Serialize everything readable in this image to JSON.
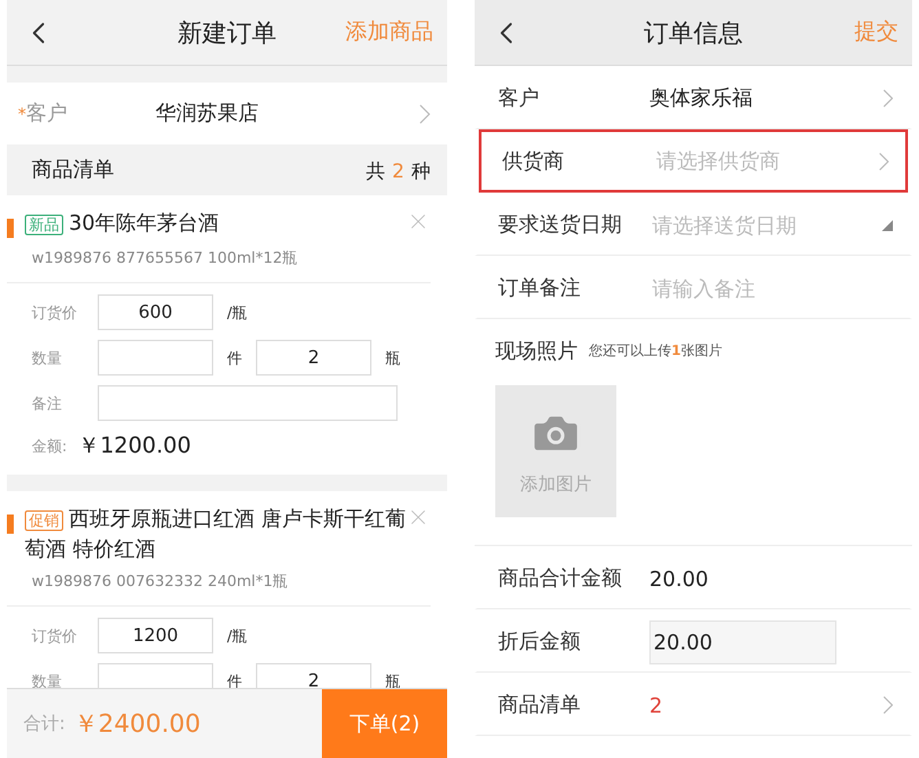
{
  "left_screen": {
    "header": {
      "title": "新建订单",
      "action": "添加商品"
    },
    "customer": {
      "label": "客户",
      "required_mark": "*",
      "value": "华润苏果店"
    },
    "list_header": {
      "title": "商品清单",
      "count_prefix": "共",
      "count": "2",
      "count_suffix": "种"
    },
    "products": [
      {
        "tag": "新品",
        "color": "#3cb07a",
        "title": "30年陈年茅台酒",
        "codes": "w1989876  877655567    100ml*12瓶",
        "rows": [
          {
            "kind": "price",
            "label": "订货价",
            "value": "600",
            "unit": "/瓶"
          },
          {
            "kind": "qty",
            "label": "数量",
            "value": "",
            "unit": "件",
            "value2": "2",
            "unit2": "瓶"
          },
          {
            "kind": "note",
            "label": "备注",
            "value": ""
          }
        ],
        "amount_label": "金额:",
        "amount": "￥1200.00"
      },
      {
        "tag": "促销",
        "color": "#f08a3c",
        "title": "西班牙原瓶进口红酒 唐卢卡斯干红葡萄酒  特价红酒",
        "codes": "w1989876  007632332    240ml*1瓶",
        "rows": [
          {
            "kind": "price",
            "label": "订货价",
            "value": "1200",
            "unit": "/瓶"
          },
          {
            "kind": "qty",
            "label": "数量",
            "value": "",
            "unit": "件",
            "value2": "2",
            "unit2": "瓶"
          }
        ]
      }
    ],
    "footer": {
      "total_label": "合计:",
      "total": "￥2400.00",
      "submit": "下单(2)"
    }
  },
  "right_screen": {
    "header": {
      "title": "订单信息",
      "action": "提交"
    },
    "rows": [
      {
        "kind": "link",
        "label": "客户",
        "value": "奥体家乐福",
        "highlighted": false
      },
      {
        "kind": "link",
        "label": "供货商",
        "placeholder": "请选择供货商",
        "highlighted": true
      },
      {
        "kind": "date",
        "label": "要求送货日期",
        "placeholder": "请选择送货日期",
        "highlighted": false
      },
      {
        "kind": "input",
        "label": "订单备注",
        "placeholder": "请输入备注",
        "highlighted": false
      },
      {
        "kind": "photo",
        "label": "现场照片",
        "hint": "您还可以上传**1**张图片",
        "button": "添加图片"
      },
      {
        "kind": "plain",
        "label": "商品合计金额",
        "value": "20.00",
        "highlighted": false
      },
      {
        "kind": "field",
        "label": "折后金额",
        "value": "20.00",
        "highlighted": false
      },
      {
        "kind": "count",
        "label": "商品清单",
        "value": "2",
        "highlighted": false
      }
    ]
  }
}
